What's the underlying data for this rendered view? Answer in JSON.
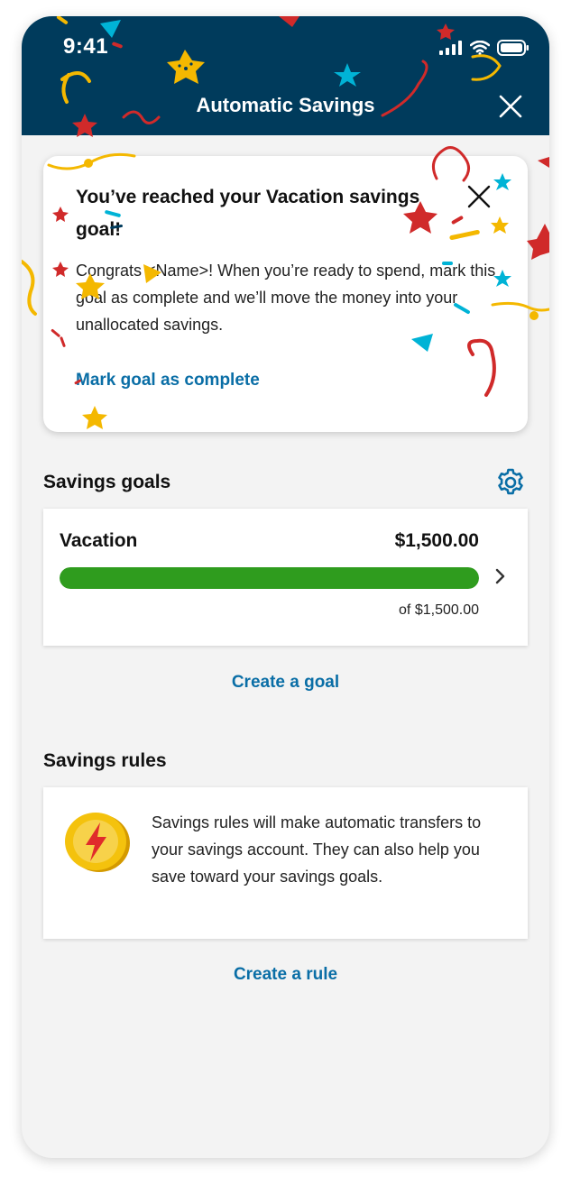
{
  "status_bar": {
    "time": "9:41"
  },
  "header": {
    "title": "Automatic Savings",
    "close_icon": "close-icon"
  },
  "banner": {
    "title": "You’ve reached your Vacation savings goal!",
    "body": "Congrats <Name>! When you’re ready to spend, mark this goal as complete and we’ll move the money into your unallocated savings.",
    "link": "Mark goal as complete"
  },
  "goals": {
    "section_title": "Savings goals",
    "settings_icon": "gear-icon",
    "items": [
      {
        "name": "Vacation",
        "amount": "$1,500.00",
        "target_text": "of $1,500.00",
        "progress_percent": 100
      }
    ],
    "create_link": "Create a goal"
  },
  "rules": {
    "section_title": "Savings rules",
    "description": "Savings rules will make automatic transfers to your savings account. They can also help you save toward your savings goals.",
    "icon": "lightning-coin-icon",
    "create_link": "Create a rule"
  },
  "colors": {
    "header_bg": "#003b5c",
    "link": "#0a6ea6",
    "progress": "#2f9c1e",
    "confetti_red": "#d02a2a",
    "confetti_yellow": "#f4b800",
    "confetti_cyan": "#00b3d6"
  }
}
